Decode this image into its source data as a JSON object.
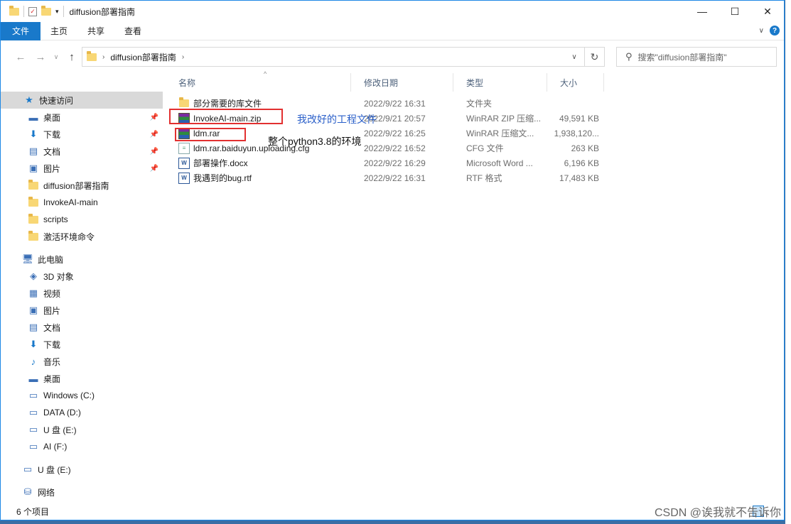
{
  "window": {
    "title": "diffusion部署指南"
  },
  "window_controls": {
    "minimize": "—",
    "maximize": "☐",
    "close": "✕"
  },
  "ribbon": {
    "tabs": [
      {
        "label": "文件",
        "active": true
      },
      {
        "label": "主页"
      },
      {
        "label": "共享"
      },
      {
        "label": "查看"
      }
    ],
    "collapse": "∨",
    "help": "?"
  },
  "nav": {
    "back": "←",
    "forward": "→",
    "recent": "∨",
    "up": "↑",
    "address_crumb": "diffusion部署指南",
    "address_dropdown": "∨",
    "refresh": "↻",
    "search_placeholder": "搜索\"diffusion部署指南\""
  },
  "sidebar": {
    "items": [
      {
        "label": "快速访问",
        "icon": "★",
        "selected": true
      },
      {
        "label": "桌面",
        "icon": "▬",
        "pinned": true
      },
      {
        "label": "下载",
        "icon": "⬇",
        "pinned": true
      },
      {
        "label": "文档",
        "icon": "▤",
        "pinned": true
      },
      {
        "label": "图片",
        "icon": "▣",
        "pinned": true
      },
      {
        "label": "diffusion部署指南",
        "icon": "folder"
      },
      {
        "label": "InvokeAI-main",
        "icon": "folder"
      },
      {
        "label": "scripts",
        "icon": "folder"
      },
      {
        "label": "激活环境命令",
        "icon": "folder"
      },
      {
        "label": "此电脑",
        "icon": "🖥"
      },
      {
        "label": "3D 对象",
        "icon": "◈"
      },
      {
        "label": "视频",
        "icon": "▦"
      },
      {
        "label": "图片",
        "icon": "▣"
      },
      {
        "label": "文档",
        "icon": "▤"
      },
      {
        "label": "下载",
        "icon": "⬇"
      },
      {
        "label": "音乐",
        "icon": "♪"
      },
      {
        "label": "桌面",
        "icon": "▬"
      },
      {
        "label": "Windows (C:)",
        "icon": "▭"
      },
      {
        "label": "DATA (D:)",
        "icon": "▭"
      },
      {
        "label": "U 盘 (E:)",
        "icon": "▭"
      },
      {
        "label": "AI (F:)",
        "icon": "▭"
      },
      {
        "label": "U 盘 (E:)",
        "icon": "▭"
      },
      {
        "label": "网络",
        "icon": "⛁"
      }
    ],
    "pin_glyph": "📌"
  },
  "columns": {
    "name": "名称",
    "modified": "修改日期",
    "type": "类型",
    "size": "大小",
    "sort_arrow": "^"
  },
  "files": [
    {
      "name": "部分需要的库文件",
      "modified": "2022/9/22 16:31",
      "type": "文件夹",
      "size": "",
      "icon": "folder"
    },
    {
      "name": "InvokeAI-main.zip",
      "modified": "2022/9/21 20:57",
      "type": "WinRAR ZIP 压缩...",
      "size": "49,591 KB",
      "icon": "rar"
    },
    {
      "name": "ldm.rar",
      "modified": "2022/9/22 16:25",
      "type": "WinRAR 压缩文...",
      "size": "1,938,120...",
      "icon": "rar"
    },
    {
      "name": "ldm.rar.baiduyun.uploading.cfg",
      "modified": "2022/9/22 16:52",
      "type": "CFG 文件",
      "size": "263 KB",
      "icon": "cfg"
    },
    {
      "name": "部署操作.docx",
      "modified": "2022/9/22 16:29",
      "type": "Microsoft Word ...",
      "size": "6,196 KB",
      "icon": "doc"
    },
    {
      "name": "我遇到的bug.rtf",
      "modified": "2022/9/22 16:31",
      "type": "RTF 格式",
      "size": "17,483 KB",
      "icon": "rtf"
    }
  ],
  "annotations": {
    "zip_note": "我改好的工程文件",
    "rar_note": "整个python3.8的环境",
    "colors": {
      "box": "#e23030",
      "zip_note": "#2a5fc9",
      "rar_note": "#111111"
    }
  },
  "status": {
    "count": "6 个项目"
  },
  "watermark": "CSDN @诶我就不告诉你"
}
